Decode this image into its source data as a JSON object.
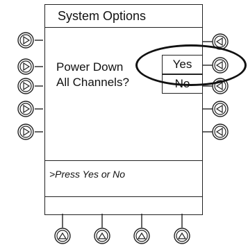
{
  "screen": {
    "title": "System Options",
    "prompt": [
      "Power Down",
      "All Channels?"
    ],
    "options": {
      "yes": "Yes",
      "no": "No"
    },
    "status": ">Press Yes or No"
  },
  "icons": {
    "left_soft_key": "triangle-right-icon",
    "right_soft_key": "triangle-left-icon",
    "bottom_soft_key": "triangle-up-icon"
  }
}
